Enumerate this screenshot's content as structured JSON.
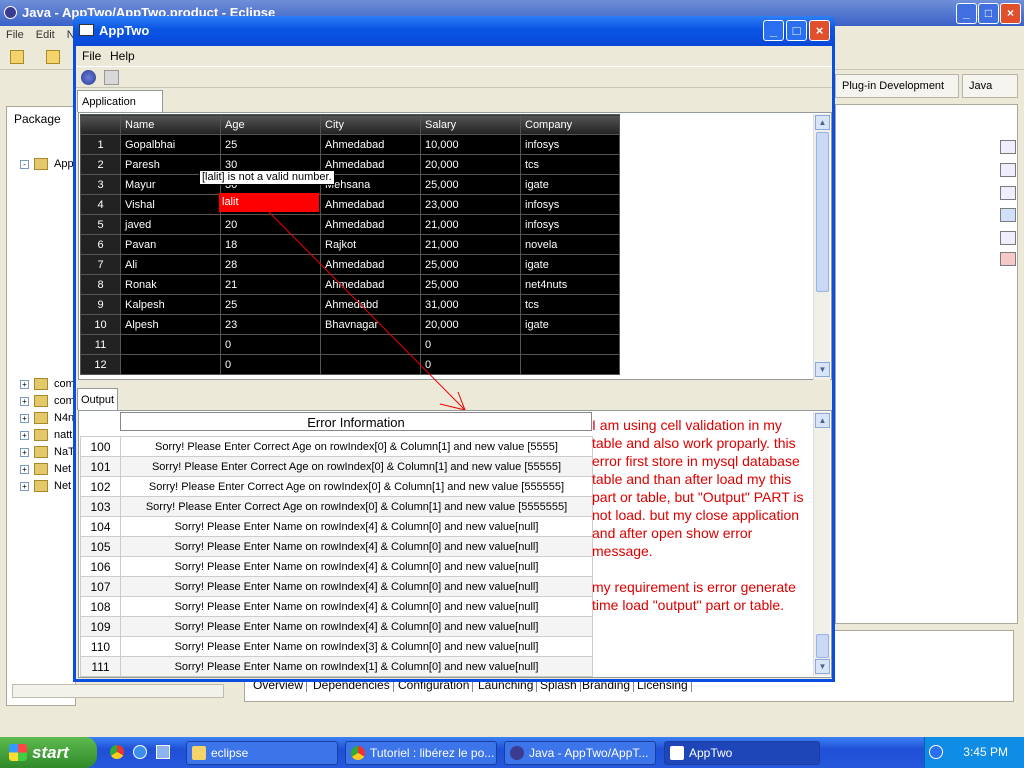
{
  "eclipse": {
    "title": "Java - AppTwo/AppTwo.product - Eclipse",
    "menu": [
      "File",
      "Edit",
      "N"
    ],
    "perspectives": [
      "Plug-in Development",
      "Java"
    ],
    "package_tab": "Package",
    "tree_items": [
      "App",
      "com",
      "com",
      "N4n",
      "natt",
      "NaT",
      "Net",
      "Net"
    ],
    "bottom_tabs": [
      "Overview",
      "Dependencies",
      "Configuration",
      "Launching",
      "Splash",
      "Branding",
      "Licensing"
    ]
  },
  "app": {
    "title": "AppTwo",
    "menu": [
      "File",
      "Help"
    ],
    "tab_data": "Application Data",
    "tab_output": "Output",
    "grid": {
      "columns": [
        "Name",
        "Age",
        "City",
        "Salary",
        "Company"
      ],
      "rows": [
        [
          "1",
          "Gopalbhai",
          "25",
          "Ahmedabad",
          "10,000",
          "infosys"
        ],
        [
          "2",
          "Paresh",
          "30",
          "Ahmedabad",
          "20,000",
          "tcs"
        ],
        [
          "3",
          "Mayur",
          "30",
          "Mehsana",
          "25,000",
          "igate"
        ],
        [
          "4",
          "Vishal",
          "",
          "Ahmedabad",
          "23,000",
          "infosys"
        ],
        [
          "5",
          "javed",
          "20",
          "Ahmedabad",
          "21,000",
          "infosys"
        ],
        [
          "6",
          "Pavan",
          "18",
          "Rajkot",
          "21,000",
          "novela"
        ],
        [
          "7",
          "Ali",
          "28",
          "Ahmedabad",
          "25,000",
          "igate"
        ],
        [
          "8",
          "Ronak",
          "21",
          "Ahmedabad",
          "25,000",
          "net4nuts"
        ],
        [
          "9",
          "Kalpesh",
          "25",
          "Ahmedabd",
          "31,000",
          "tcs"
        ],
        [
          "10",
          "Alpesh",
          "23",
          "Bhavnagar",
          "20,000",
          "igate"
        ],
        [
          "11",
          "",
          "0",
          "",
          "0",
          ""
        ],
        [
          "12",
          "",
          "0",
          "",
          "0",
          ""
        ]
      ],
      "tooltip": "[lalit] is not a valid number.",
      "edit_value": "lalit"
    },
    "errors": {
      "header": "Error Information",
      "rows": [
        [
          "100",
          "Sorry! Please Enter Correct Age on rowIndex[0] & Column[1] and new value [5555]"
        ],
        [
          "101",
          "Sorry! Please Enter Correct Age on rowIndex[0] & Column[1] and new value [55555]"
        ],
        [
          "102",
          "Sorry! Please Enter Correct Age on rowIndex[0] & Column[1] and new value [555555]"
        ],
        [
          "103",
          "Sorry! Please Enter Correct Age on rowIndex[0] & Column[1] and new value [5555555]"
        ],
        [
          "104",
          "Sorry! Please Enter Name on rowIndex[4] & Column[0] and new value[null]"
        ],
        [
          "105",
          "Sorry! Please Enter Name on rowIndex[4] & Column[0] and new value[null]"
        ],
        [
          "106",
          "Sorry! Please Enter Name on rowIndex[4] & Column[0] and new value[null]"
        ],
        [
          "107",
          "Sorry! Please Enter Name on rowIndex[4] & Column[0] and new value[null]"
        ],
        [
          "108",
          "Sorry! Please Enter Name on rowIndex[4] & Column[0] and new value[null]"
        ],
        [
          "109",
          "Sorry! Please Enter Name on rowIndex[4] & Column[0] and new value[null]"
        ],
        [
          "110",
          "Sorry! Please Enter Name on rowIndex[3] & Column[0] and new value[null]"
        ],
        [
          "111",
          "Sorry! Please Enter Name on rowIndex[1] & Column[0] and new value[null]"
        ]
      ]
    },
    "note": "I am using cell validation in my table and also work proparly. this error first store in mysql database table and than after load my this part or table, but \"Output\" PART is not load. but my close application and after open show error message.\n\nmy requirement is error generate time  load \"output\" part or table."
  },
  "taskbar": {
    "start": "start",
    "tasks": [
      "eclipse",
      "Tutoriel : libérez le po...",
      "Java - AppTwo/AppT...",
      "AppTwo"
    ],
    "clock": "3:45 PM"
  },
  "colors": {
    "title_blue": "#0a55e4",
    "error_red": "#ff0000",
    "note_red": "#dd0000"
  }
}
